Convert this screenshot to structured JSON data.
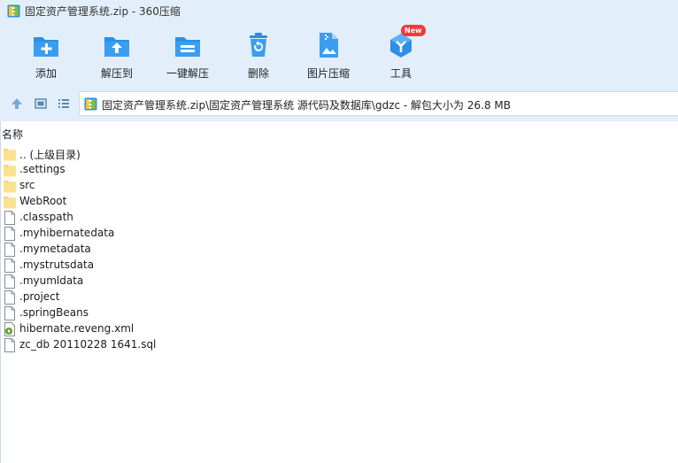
{
  "window": {
    "title": "固定资产管理系统.zip - 360压缩"
  },
  "toolbar": {
    "buttons": [
      {
        "label": "添加",
        "icon": "add-icon"
      },
      {
        "label": "解压到",
        "icon": "extract-to-icon"
      },
      {
        "label": "一键解压",
        "icon": "one-click-extract-icon"
      },
      {
        "label": "删除",
        "icon": "delete-icon"
      },
      {
        "label": "图片压缩",
        "icon": "image-compress-icon"
      },
      {
        "label": "工具",
        "icon": "tools-icon",
        "badge": "New"
      }
    ]
  },
  "address": {
    "path": "固定资产管理系统.zip\\固定资产管理系统 源代码及数据库\\gdzc - 解包大小为 26.8 MB"
  },
  "list": {
    "column_name": "名称",
    "items": [
      {
        "name": ".. (上级目录)",
        "type": "folder"
      },
      {
        "name": ".settings",
        "type": "folder"
      },
      {
        "name": "src",
        "type": "folder"
      },
      {
        "name": "WebRoot",
        "type": "folder"
      },
      {
        "name": ".classpath",
        "type": "file"
      },
      {
        "name": ".myhibernatedata",
        "type": "file"
      },
      {
        "name": ".mymetadata",
        "type": "file"
      },
      {
        "name": ".mystrutsdata",
        "type": "file"
      },
      {
        "name": ".myumldata",
        "type": "file"
      },
      {
        "name": ".project",
        "type": "file"
      },
      {
        "name": ".springBeans",
        "type": "file"
      },
      {
        "name": "hibernate.reveng.xml",
        "type": "xml"
      },
      {
        "name": "zc_db 20110228 1641.sql",
        "type": "file"
      }
    ]
  },
  "colors": {
    "toolbar_bg": "#e2effb",
    "icon_blue": "#2d8fe4",
    "folder_yellow": "#f7d774",
    "badge_red": "#f03b3b"
  }
}
